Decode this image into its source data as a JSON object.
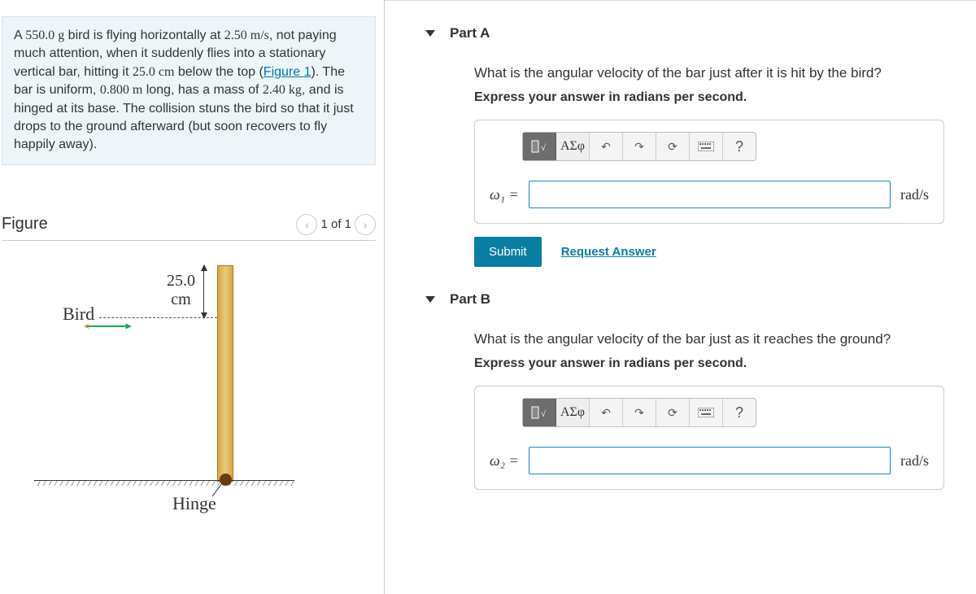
{
  "problem": {
    "text_html": "A 550.0 g bird is flying horizontally at 2.50 m/s, not paying much attention, when it suddenly flies into a stationary vertical bar, hitting it 25.0 cm below the top (Figure 1). The bar is uniform, 0.800 m long, has a mass of 2.40 kg, and is hinged at its base. The collision stuns the bird so that it just drops to the ground afterward (but soon recovers to fly happily away).",
    "mass_bird": "550.0 g",
    "velocity": "2.50 m/s",
    "hit_distance": "25.0 cm",
    "figure_ref": "Figure 1",
    "bar_length": "0.800 m",
    "bar_mass": "2.40 kg"
  },
  "figure": {
    "title": "Figure",
    "page": "1 of 1",
    "bird_label": "Bird",
    "measure_value": "25.0",
    "measure_unit": "cm",
    "hinge_label": "Hinge"
  },
  "partA": {
    "header": "Part A",
    "question": "What is the angular velocity of the bar just after it is hit by the bird?",
    "instruction": "Express your answer in radians per second.",
    "variable": "ω₁ =",
    "unit": "rad/s",
    "submit": "Submit",
    "request": "Request Answer",
    "greek_btn": "ΑΣφ"
  },
  "partB": {
    "header": "Part B",
    "question": "What is the angular velocity of the bar just as it reaches the ground?",
    "instruction": "Express your answer in radians per second.",
    "variable": "ω₂ =",
    "unit": "rad/s",
    "greek_btn": "ΑΣφ"
  }
}
